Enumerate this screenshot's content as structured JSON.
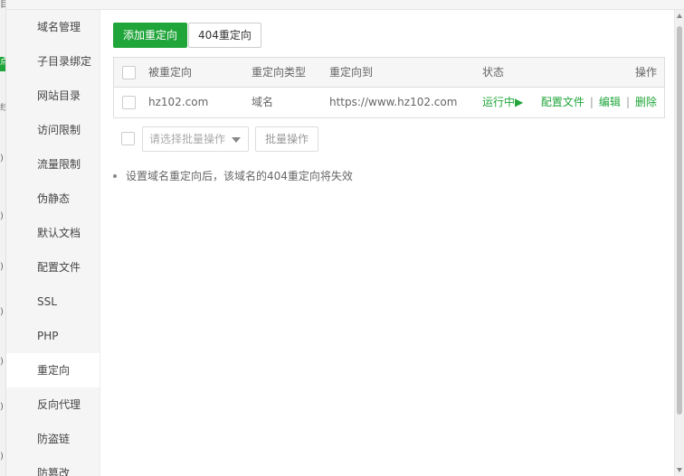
{
  "background_page": {
    "strip_glyphs": [
      "目",
      "点",
      "线",
      ")",
      ")",
      ")",
      ")",
      ")",
      ")",
      ")"
    ]
  },
  "sidebar": {
    "items": [
      {
        "label": "域名管理",
        "active": false
      },
      {
        "label": "子目录绑定",
        "active": false
      },
      {
        "label": "网站目录",
        "active": false
      },
      {
        "label": "访问限制",
        "active": false
      },
      {
        "label": "流量限制",
        "active": false
      },
      {
        "label": "伪静态",
        "active": false
      },
      {
        "label": "默认文档",
        "active": false
      },
      {
        "label": "配置文件",
        "active": false
      },
      {
        "label": "SSL",
        "active": false
      },
      {
        "label": "PHP",
        "active": false
      },
      {
        "label": "重定向",
        "active": true
      },
      {
        "label": "反向代理",
        "active": false
      },
      {
        "label": "防盗链",
        "active": false
      },
      {
        "label": "防篡改",
        "active": false
      }
    ]
  },
  "toolbar": {
    "add_redirect_label": "添加重定向",
    "redirect_404_label": "404重定向"
  },
  "table": {
    "headers": {
      "source": "被重定向",
      "type": "重定向类型",
      "target": "重定向到",
      "status": "状态",
      "actions": "操作"
    },
    "rows": [
      {
        "source": "hz102.com",
        "type": "域名",
        "target": "https://www.hz102.com",
        "status": "运行中▶",
        "action_config": "配置文件",
        "action_edit": "编辑",
        "action_delete": "删除",
        "separator": "|"
      }
    ]
  },
  "batch": {
    "select_placeholder": "请选择批量操作",
    "button_label": "批量操作"
  },
  "note": {
    "text": "设置域名重定向后，该域名的404重定向将失效"
  },
  "colors": {
    "accent": "#20a53a",
    "sidebar_bg": "#f5f5f5"
  }
}
